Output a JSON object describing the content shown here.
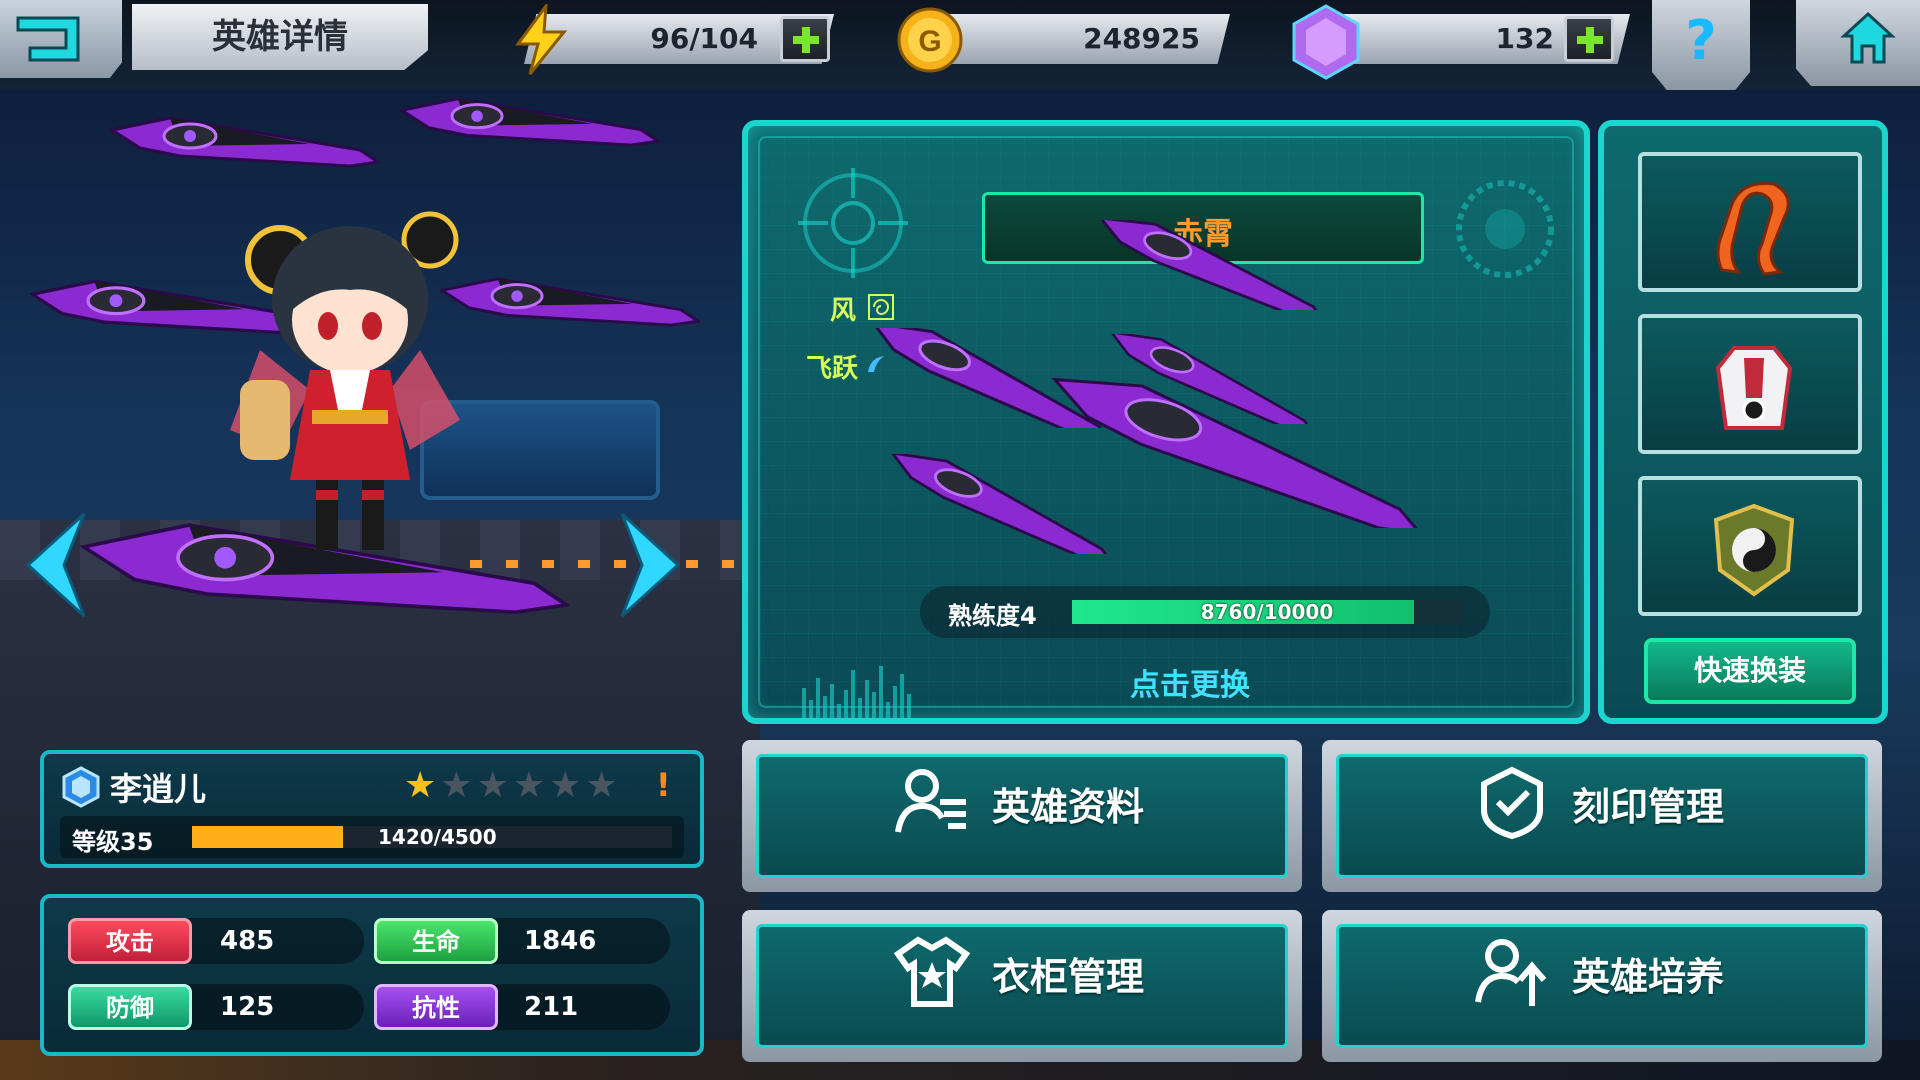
{
  "topbar": {
    "title": "英雄详情",
    "energy": "96/104",
    "gold": "248925",
    "gems": "132",
    "help_symbol": "?"
  },
  "equipment": {
    "name": "赤霄",
    "element_label": "风",
    "skill_label": "飞跃",
    "proficiency_label": "熟练度4",
    "proficiency_value": "8760/10000",
    "proficiency_ratio": 0.876,
    "change_label": "点击更换"
  },
  "side_slots": {
    "slots": [
      {
        "icon": "scarf-icon"
      },
      {
        "icon": "armor-icon"
      },
      {
        "icon": "yinyang-emblem-icon"
      }
    ],
    "quick_equip_label": "快速换装"
  },
  "hero": {
    "name": "李逍儿",
    "stars_filled": 1,
    "stars_total": 6,
    "alert": "!",
    "level_label": "等级35",
    "exp_text": "1420/4500",
    "exp_ratio": 0.3156
  },
  "stats": {
    "attack_label": "攻击",
    "attack_value": "485",
    "hp_label": "生命",
    "hp_value": "1846",
    "defense_label": "防御",
    "defense_value": "125",
    "resist_label": "抗性",
    "resist_value": "211"
  },
  "menu": {
    "hero_info": "英雄资料",
    "engrave": "刻印管理",
    "wardrobe": "衣柜管理",
    "train": "英雄培养"
  },
  "colors": {
    "accent": "#1bd6cf",
    "gold": "#ffb01a",
    "attack": "#e0304a",
    "hp": "#2fcc5a",
    "defense": "#22c08a",
    "resist": "#8a3ad8"
  }
}
